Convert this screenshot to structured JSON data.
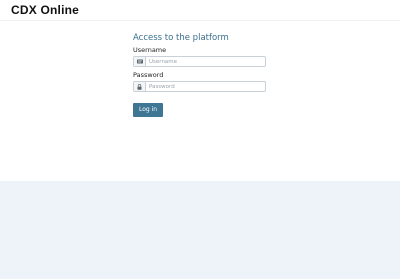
{
  "header": {
    "logo_text": "CDX Online"
  },
  "login": {
    "title": "Access to the platform",
    "username_label": "Username",
    "username_placeholder": "Username",
    "username_icon": "user-icon",
    "password_label": "Password",
    "password_placeholder": "Password",
    "password_icon": "lock-icon",
    "submit_label": "Log in"
  },
  "colors": {
    "accent": "#3f7694",
    "title": "#3a6e8d",
    "footer_background": "#eef3f9"
  }
}
